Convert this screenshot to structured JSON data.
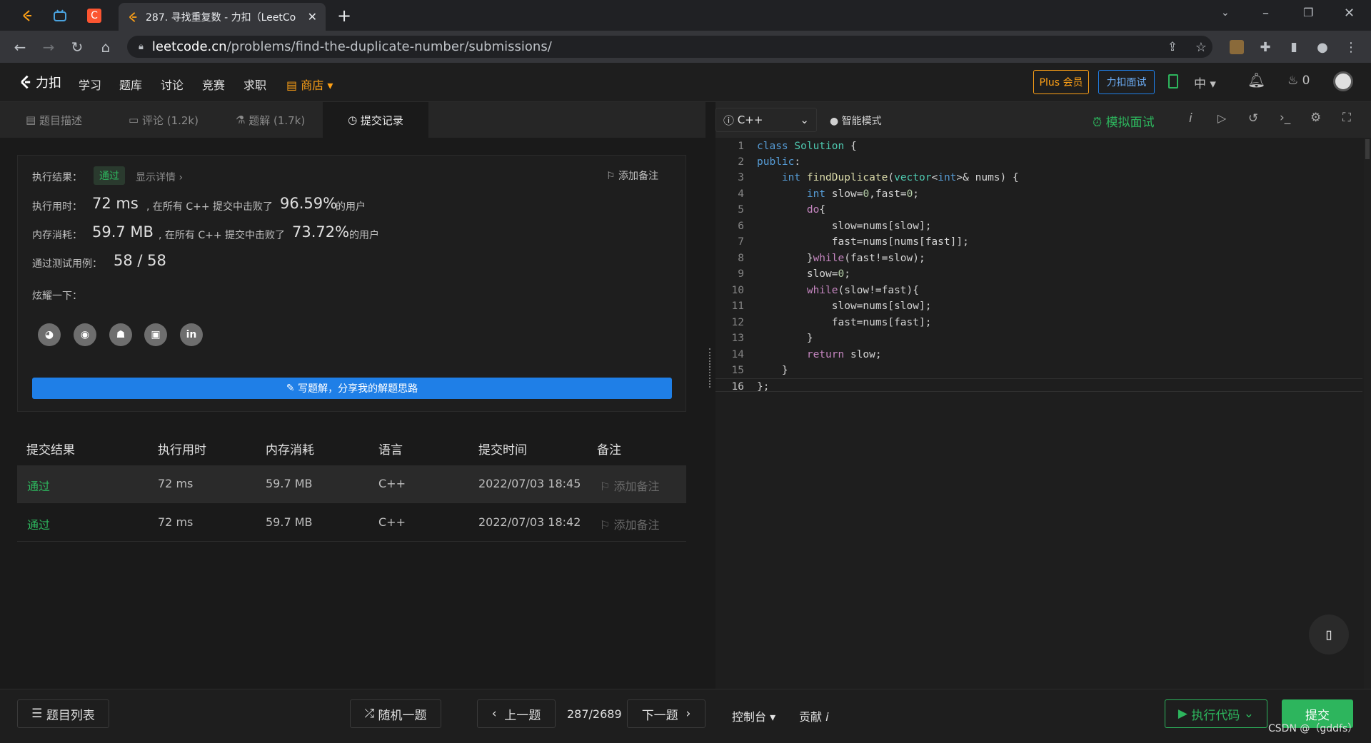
{
  "browser": {
    "tab_title": "287. 寻找重复数 - 力扣（LeetCo",
    "url_host": "leetcode.cn",
    "url_path": "/problems/find-the-duplicate-number/submissions/"
  },
  "header": {
    "logo": "力扣",
    "nav": [
      "学习",
      "题库",
      "讨论",
      "竞赛",
      "求职"
    ],
    "shop": "商店",
    "plus_label": "Plus 会员",
    "interview_label": "力扣面试",
    "lang_switch": "中",
    "streak_count": "0"
  },
  "left_tabs": {
    "description": "题目描述",
    "comments": "评论 (1.2k)",
    "solutions": "题解 (1.7k)",
    "submissions": "提交记录"
  },
  "result": {
    "status_label": "执行结果：",
    "status": "通过",
    "details_link": "显示详情 ›",
    "add_note": "添加备注",
    "runtime_label": "执行用时：",
    "runtime": "72 ms",
    "runtime_desc": ", 在所有 C++ 提交中击败了",
    "runtime_pct": "96.59%",
    "users": "的用户",
    "memory_label": "内存消耗：",
    "memory": "59.7 MB",
    "memory_desc": ", 在所有 C++ 提交中击败了",
    "memory_pct": "73.72%",
    "tests_label": "通过测试用例：",
    "tests": "58 / 58",
    "share_label": "炫耀一下：",
    "write_solution": "写题解，分享我的解题思路"
  },
  "table": {
    "headers": [
      "提交结果",
      "执行用时",
      "内存消耗",
      "语言",
      "提交时间",
      "备注"
    ],
    "rows": [
      {
        "status": "通过",
        "time": "72 ms",
        "memory": "59.7 MB",
        "lang": "C++",
        "submitted": "2022/07/03 18:45",
        "note": "添加备注"
      },
      {
        "status": "通过",
        "time": "72 ms",
        "memory": "59.7 MB",
        "lang": "C++",
        "submitted": "2022/07/03 18:42",
        "note": "添加备注"
      }
    ]
  },
  "editor": {
    "language": "C++",
    "mode": "智能模式",
    "mock_interview": "模拟面试",
    "lines": [
      "1",
      "2",
      "3",
      "4",
      "5",
      "6",
      "7",
      "8",
      "9",
      "10",
      "11",
      "12",
      "13",
      "14",
      "15",
      "16"
    ]
  },
  "bottom": {
    "problem_list": "题目列表",
    "random": "随机一题",
    "prev": "上一题",
    "progress": "287/2689",
    "next": "下一题",
    "console": "控制台",
    "contribute": "贡献",
    "run": "执行代码",
    "submit": "提交",
    "watermark": "CSDN @（gddfs）"
  },
  "colors": {
    "accept_green": "#2db55d",
    "link_blue": "#1f7fe7",
    "plus_orange": "#ffa116"
  }
}
